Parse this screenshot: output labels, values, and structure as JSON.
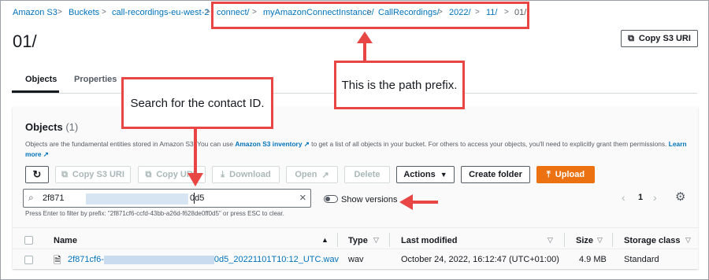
{
  "breadcrumb": {
    "items": [
      "Amazon S3",
      "Buckets",
      "call-recordings-eu-west-2",
      "connect/",
      "myAmazonConnectInstance/",
      "CallRecordings/",
      "2022/",
      "11/",
      "01/"
    ]
  },
  "page": {
    "title": "01/",
    "copy_uri_label": "Copy S3 URI"
  },
  "tabs": [
    "Objects",
    "Properties"
  ],
  "objects": {
    "title": "Objects",
    "count": "(1)",
    "desc_a": "Objects are the fundamental entities stored in Amazon S3. You can use ",
    "desc_link1": "Amazon S3 inventory",
    "desc_b": " to get a list of all objects in your bucket. For others to access your objects, you'll need to explicitly grant them permissions. ",
    "desc_link2": "Learn more"
  },
  "toolbar": {
    "copy_uri": "Copy S3 URI",
    "copy_url": "Copy URL",
    "download": "Download",
    "open": "Open",
    "delete": "Delete",
    "actions": "Actions",
    "create_folder": "Create folder",
    "upload": "Upload"
  },
  "search": {
    "value_start": "2f871",
    "value_end": "0d5",
    "hint": "Press Enter to filter by prefix: \"2f871cf6-ccfd-43bb-a26d-f628de0ff0d5\" or press ESC to clear."
  },
  "versions": {
    "label": "Show versions"
  },
  "pagination": {
    "page": "1"
  },
  "table": {
    "columns": [
      "Name",
      "Type",
      "Last modified",
      "Size",
      "Storage class"
    ],
    "rows": [
      {
        "name_start": "2f871cf6-",
        "name_end": "0d5_20221101T10:12_UTC.wav",
        "type": "wav",
        "modified": "October 24, 2022, 16:12:47 (UTC+01:00)",
        "size": "4.9 MB",
        "storage": "Standard"
      }
    ]
  },
  "callouts": {
    "search": "Search for the contact ID.",
    "prefix": "This is the path prefix."
  },
  "colors": {
    "accent": "#0073bb",
    "callout": "#e84545",
    "primary": "#ec7211"
  }
}
